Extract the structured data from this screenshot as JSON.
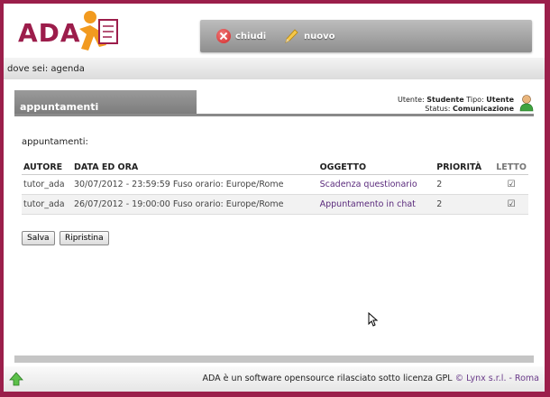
{
  "header": {
    "logo_text": "ADA",
    "close_label": "chiudi",
    "new_label": "nuovo"
  },
  "breadcrumb": "dove sei: agenda",
  "panel": {
    "title": "appuntamenti",
    "user_label": "Utente:",
    "user_value": "Studente",
    "type_label": "Tipo:",
    "type_value": "Utente",
    "status_label": "Status:",
    "status_value": "Comunicazione",
    "subtitle": "appuntamenti:"
  },
  "table": {
    "headers": [
      "AUTORE",
      "DATA ED ORA",
      "OGGETTO",
      "PRIORITÀ",
      "LETTO"
    ],
    "rows": [
      {
        "author": "tutor_ada",
        "datetime": "30/07/2012 - 23:59:59 Fuso orario: Europe/Rome",
        "subject": "Scadenza questionario",
        "priority": "2",
        "read": true
      },
      {
        "author": "tutor_ada",
        "datetime": "26/07/2012 - 19:00:00 Fuso orario: Europe/Rome",
        "subject": "Appuntamento in chat",
        "priority": "2",
        "read": true
      }
    ]
  },
  "buttons": {
    "save": "Salva",
    "reset": "Ripristina"
  },
  "footer": {
    "text": "ADA è un software opensource rilasciato sotto licenza GPL",
    "link": "© Lynx s.r.l. - Roma"
  },
  "colors": {
    "brand": "#9b1f4b",
    "link": "#5a2a7c"
  }
}
